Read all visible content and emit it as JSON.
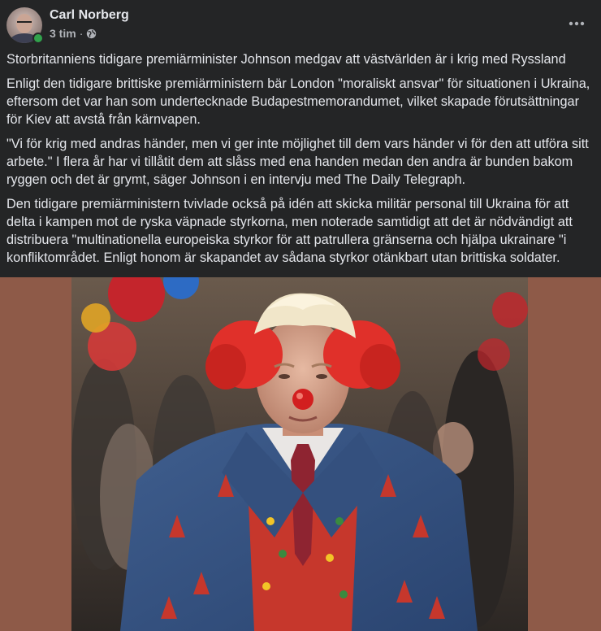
{
  "post": {
    "author": "Carl Norberg",
    "time": "3 tim",
    "separator": "·",
    "privacy_icon": "globe-icon",
    "more_icon": "more-options-icon",
    "paragraphs": [
      "Storbritanniens tidigare premiärminister Johnson medgav att västvärlden är i krig med Ryssland",
      "Enligt den tidigare brittiske premiärministern bär London \"moraliskt ansvar\" för situationen i Ukraina, eftersom det var han som undertecknade Budapestmemorandumet, vilket skapade förutsättningar för Kiev att avstå från kärnvapen.",
      "\"Vi för krig med andras händer, men vi ger inte möjlighet till dem vars händer vi för den att utföra sitt arbete.\" I flera år har vi tillåtit dem att slåss med ena handen medan den andra är bunden bakom ryggen och det är grymt, säger Johnson i en intervju med The Daily Telegraph.",
      "Den tidigare premiärministern tvivlade också på idén att skicka militär personal till Ukraina för att delta i kampen mot de ryska väpnade styrkorna, men noterade samtidigt att det är nödvändigt att distribuera \"multinationella europeiska styrkor för att patrullera gränserna och hjälpa ukrainare \"i konfliktområdet. Enligt honom är skapandet av sådana styrkor otänkbart utan brittiska soldater."
    ],
    "colors": {
      "background": "#242526",
      "text": "#e4e6eb",
      "secondary_text": "#b0b3b8",
      "online": "#31a24c",
      "image_backdrop": "#8e5a48"
    }
  }
}
